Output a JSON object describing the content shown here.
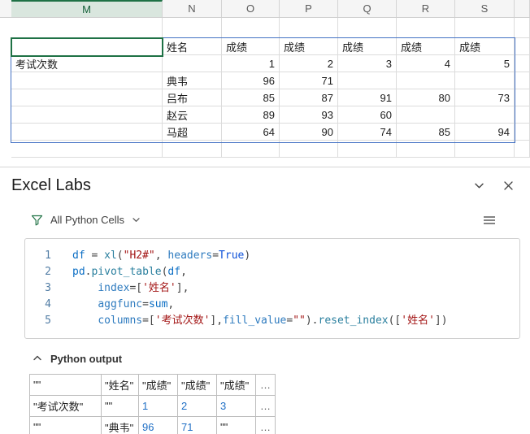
{
  "spreadsheet": {
    "columns": [
      "M",
      "N",
      "O",
      "P",
      "Q",
      "R",
      "S"
    ],
    "selected_column": "M",
    "rows": [
      [
        "",
        "姓名",
        "成绩",
        "成绩",
        "成绩",
        "成绩",
        "成绩"
      ],
      [
        "考试次数",
        "",
        "1",
        "2",
        "3",
        "4",
        "5"
      ],
      [
        "",
        "典韦",
        "96",
        "71",
        "",
        "",
        ""
      ],
      [
        "",
        "吕布",
        "85",
        "87",
        "91",
        "80",
        "73"
      ],
      [
        "",
        "赵云",
        "89",
        "93",
        "60",
        "",
        ""
      ],
      [
        "",
        "马超",
        "64",
        "90",
        "74",
        "85",
        "94"
      ]
    ]
  },
  "panel": {
    "title": "Excel Labs",
    "filter_label": "All Python Cells",
    "output_label": "Python output"
  },
  "code": {
    "lines": [
      {
        "num": "1",
        "tokens": [
          {
            "t": "df",
            "c": "v"
          },
          {
            "t": " = ",
            "c": "p"
          },
          {
            "t": "xl",
            "c": "f"
          },
          {
            "t": "(",
            "c": "p"
          },
          {
            "t": "\"H2#\"",
            "c": "s"
          },
          {
            "t": ", ",
            "c": "p"
          },
          {
            "t": "headers",
            "c": "a"
          },
          {
            "t": "=",
            "c": "p"
          },
          {
            "t": "True",
            "c": "k"
          },
          {
            "t": ")",
            "c": "p"
          }
        ]
      },
      {
        "num": "2",
        "tokens": [
          {
            "t": "pd",
            "c": "v"
          },
          {
            "t": ".",
            "c": "p"
          },
          {
            "t": "pivot_table",
            "c": "f"
          },
          {
            "t": "(",
            "c": "p"
          },
          {
            "t": "df",
            "c": "v"
          },
          {
            "t": ",",
            "c": "p"
          }
        ]
      },
      {
        "num": "3",
        "tokens": [
          {
            "t": "    ",
            "c": "p"
          },
          {
            "t": "index",
            "c": "a"
          },
          {
            "t": "=[",
            "c": "p"
          },
          {
            "t": "'姓名'",
            "c": "s"
          },
          {
            "t": "],",
            "c": "p"
          }
        ]
      },
      {
        "num": "4",
        "tokens": [
          {
            "t": "    ",
            "c": "p"
          },
          {
            "t": "aggfunc",
            "c": "a"
          },
          {
            "t": "=",
            "c": "p"
          },
          {
            "t": "sum",
            "c": "v"
          },
          {
            "t": ",",
            "c": "p"
          }
        ]
      },
      {
        "num": "5",
        "tokens": [
          {
            "t": "    ",
            "c": "p"
          },
          {
            "t": "columns",
            "c": "a"
          },
          {
            "t": "=[",
            "c": "p"
          },
          {
            "t": "'考试次数'",
            "c": "s"
          },
          {
            "t": "],",
            "c": "p"
          },
          {
            "t": "fill_value",
            "c": "a"
          },
          {
            "t": "=",
            "c": "p"
          },
          {
            "t": "\"\"",
            "c": "s"
          },
          {
            "t": ").",
            "c": "p"
          },
          {
            "t": "reset_index",
            "c": "f"
          },
          {
            "t": "([",
            "c": "p"
          },
          {
            "t": "'姓名'",
            "c": "s"
          },
          {
            "t": "])",
            "c": "p"
          }
        ]
      }
    ]
  },
  "output_table": {
    "rows": [
      [
        {
          "t": "\"\"",
          "c": "s"
        },
        {
          "t": "\"姓名\"",
          "c": "s"
        },
        {
          "t": "\"成绩\"",
          "c": "s"
        },
        {
          "t": "\"成绩\"",
          "c": "s"
        },
        {
          "t": "\"成绩\"",
          "c": "s"
        },
        {
          "t": "…",
          "c": "e"
        }
      ],
      [
        {
          "t": "\"考试次数\"",
          "c": "s"
        },
        {
          "t": "\"\"",
          "c": "s"
        },
        {
          "t": "1",
          "c": "n"
        },
        {
          "t": "2",
          "c": "n"
        },
        {
          "t": "3",
          "c": "n"
        },
        {
          "t": "…",
          "c": "e"
        }
      ],
      [
        {
          "t": "\"\"",
          "c": "s"
        },
        {
          "t": "\"典韦\"",
          "c": "s"
        },
        {
          "t": "96",
          "c": "n"
        },
        {
          "t": "71",
          "c": "n"
        },
        {
          "t": "\"\"",
          "c": "s"
        },
        {
          "t": "…",
          "c": "e"
        }
      ]
    ]
  },
  "colors": {
    "excel_green": "#217346",
    "selection_green": "#1e7145",
    "range_border_blue": "#4472c4",
    "code_string": "#a31515",
    "code_identifier": "#0b6ec4",
    "output_number_blue": "#1f6fc5"
  }
}
